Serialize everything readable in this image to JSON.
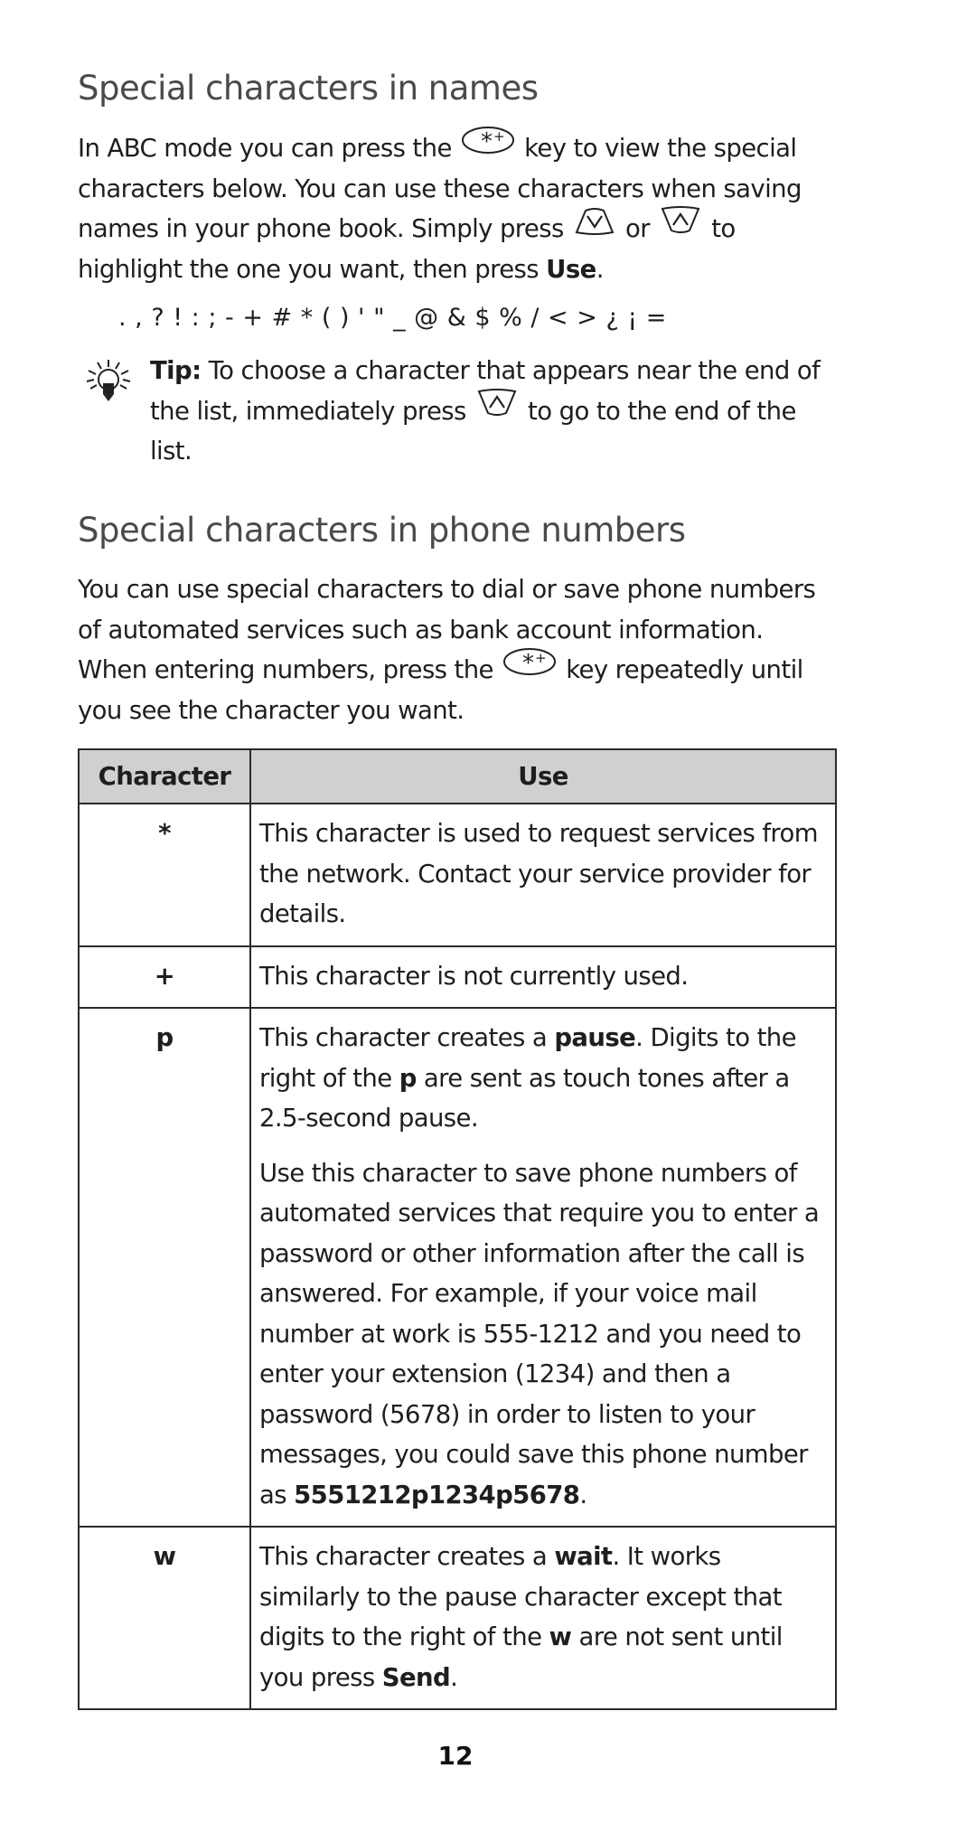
{
  "section1": {
    "title": "Special characters in names",
    "para": {
      "p1": "In ABC mode you can press the",
      "key1_icon": "star-plus-key-icon",
      "p2": "key to view the special characters below. You can use these characters when saving names in your phone book. Simply press",
      "key2_icon": "scroll-down-key-icon",
      "p3": "or",
      "key3_icon": "scroll-up-key-icon",
      "p4": "to highlight the one you want, then press",
      "bold": "Use",
      "end": "."
    },
    "char_list": ". , ? ! : ; - + # * ( ) ' \" _ @ & $ % / < > ¿ ¡ =",
    "tip": {
      "icon": "lightbulb-icon",
      "label": "Tip:",
      "t1": " To choose a character that appears near the end of the list, immediately press",
      "key_icon": "scroll-up-key-icon",
      "t2": "to go to the end of the list."
    }
  },
  "section2": {
    "title": "Special characters in phone numbers",
    "para": {
      "p1": "You can use special characters to dial or save phone numbers of automated services such as bank account information. When entering numbers, press the",
      "key_icon": "star-plus-key-icon",
      "p2": "key repeatedly until you see the character you want."
    }
  },
  "table": {
    "headers": [
      "Character",
      "Use"
    ],
    "rows": [
      {
        "char": "*",
        "use": [
          "This character is used to request services from the network. Contact your service provider for details."
        ]
      },
      {
        "char": "+",
        "use": [
          "This character is not currently used."
        ]
      },
      {
        "char": "p",
        "use_p1": {
          "a": "This character creates a ",
          "b": "pause",
          "c": ". Digits to the right of the ",
          "d": "p",
          "e": " are sent as touch tones after a 2.5-second pause."
        },
        "use_p2": {
          "a": "Use this character to save phone numbers of automated services that require you to enter a password or other information after the call is answered. For example, if your voice mail number at work is 555-1212 and you need to enter your extension (1234) and then a password (5678) in order to listen to your messages, you could save this phone number as ",
          "b": "5551212p1234p5678",
          "c": "."
        }
      },
      {
        "char": "w",
        "use_p1": {
          "a": "This character creates a ",
          "b": "wait",
          "c": ". It works similarly to the pause character except that digits to the right of the ",
          "d": "w",
          "e": " are not sent until you press ",
          "f": "Send",
          "g": "."
        }
      }
    ]
  },
  "page_number": "12"
}
